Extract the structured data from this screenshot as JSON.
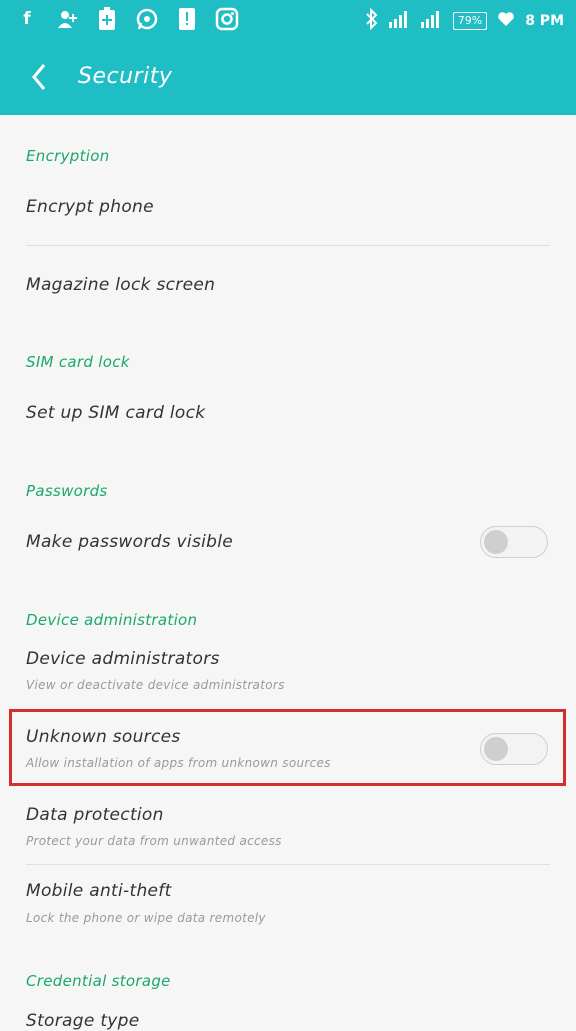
{
  "statusbar": {
    "left_icons": [
      "facebook-icon",
      "add-user-icon",
      "battery-plus-icon",
      "whatsapp-icon",
      "alert-icon",
      "instagram-icon"
    ],
    "battery": "79%",
    "time": "8 PM"
  },
  "toolbar": {
    "title": "Security"
  },
  "sections": {
    "encryption": {
      "header": "Encryption",
      "encrypt_phone": "Encrypt phone",
      "magazine_lock": "Magazine lock screen"
    },
    "sim": {
      "header": "SIM card lock",
      "setup": "Set up SIM card lock"
    },
    "passwords": {
      "header": "Passwords",
      "visible": "Make passwords visible",
      "visible_enabled": false
    },
    "device_admin": {
      "header": "Device administration",
      "administrators": "Device administrators",
      "administrators_sub": "View or deactivate device administrators",
      "unknown": "Unknown sources",
      "unknown_sub": "Allow installation of apps from unknown sources",
      "unknown_enabled": false,
      "data_protection": "Data protection",
      "data_protection_sub": "Protect your data from unwanted access",
      "anti_theft": "Mobile anti-theft",
      "anti_theft_sub": "Lock the phone or wipe data remotely"
    },
    "credential": {
      "header": "Credential storage",
      "storage_type": "Storage type"
    }
  },
  "colors": {
    "accent": "#1fbdc4",
    "section_header": "#1aa86b",
    "highlight": "#d32f2f"
  }
}
